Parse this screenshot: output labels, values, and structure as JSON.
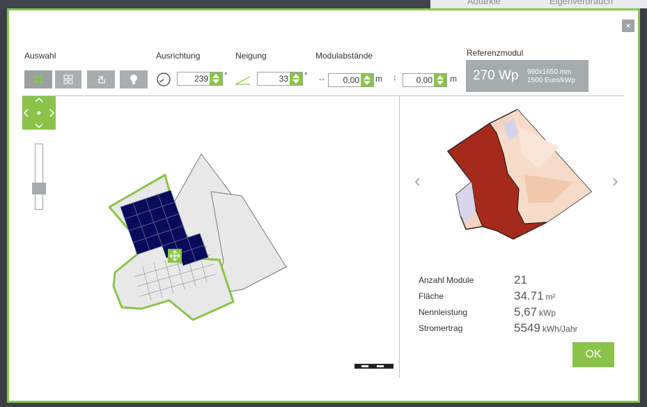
{
  "background": {
    "tab1": "Autarkie",
    "tab2": "Eigenverbrauch"
  },
  "toolbar": {
    "auswahl_label": "Auswahl",
    "ausrichtung_label": "Ausrichtung",
    "ausrichtung_value": "239",
    "ausrichtung_unit": "°",
    "neigung_label": "Neigung",
    "neigung_value": "33",
    "neigung_unit": "°",
    "modulabstaende_label": "Modulabstände",
    "abstand_h_value": "0,00",
    "abstand_h_unit": "m",
    "abstand_v_value": "0,00",
    "abstand_v_unit": "m"
  },
  "referenzmodul": {
    "label": "Referenzmodul",
    "power": "270 Wp",
    "dimensions": "990x1650 mm",
    "price": "1500 Euro/kWp"
  },
  "stats": {
    "anzahl_label": "Anzahl Module",
    "anzahl_value": "21",
    "flaeche_label": "Fläche",
    "flaeche_value": "34.71",
    "flaeche_unit": "m²",
    "nennleistung_label": "Nennleistung",
    "nennleistung_value": "5,67",
    "nennleistung_unit": "kWp",
    "stromertrag_label": "Stromertrag",
    "stromertrag_value": "5549",
    "stromertrag_unit": "kWh/Jahr"
  },
  "ok_label": "OK",
  "close_label": "×",
  "colors": {
    "accent": "#8bc34a",
    "panel": "#0a0a5a",
    "roof": "#e8e8e8",
    "heat_dark": "#a52a1a",
    "heat_light": "#f3d3bd"
  }
}
